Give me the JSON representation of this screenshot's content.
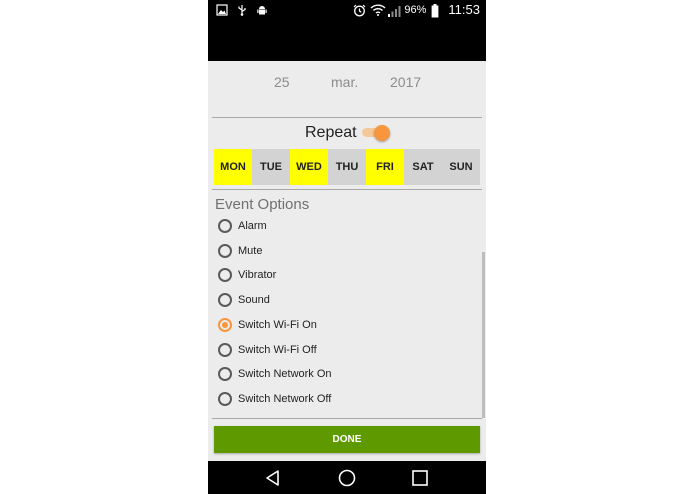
{
  "status_bar": {
    "battery_percent": "96%",
    "time": "11:53",
    "icons": [
      "image-icon",
      "usb-icon",
      "android-icon",
      "alarm-icon",
      "wifi-icon",
      "signal-icon",
      "battery-icon"
    ]
  },
  "date": {
    "day": "25",
    "month": "mar.",
    "year": "2017"
  },
  "repeat": {
    "label": "Repeat",
    "enabled": true
  },
  "days": [
    {
      "label": "MON",
      "selected": true
    },
    {
      "label": "TUE",
      "selected": false
    },
    {
      "label": "WED",
      "selected": true
    },
    {
      "label": "THU",
      "selected": false
    },
    {
      "label": "FRI",
      "selected": true
    },
    {
      "label": "SAT",
      "selected": false
    },
    {
      "label": "SUN",
      "selected": false
    }
  ],
  "event_options": {
    "title": "Event Options",
    "options": [
      {
        "label": "Alarm",
        "selected": false
      },
      {
        "label": "Mute",
        "selected": false
      },
      {
        "label": "Vibrator",
        "selected": false
      },
      {
        "label": "Sound",
        "selected": false
      },
      {
        "label": "Switch Wi-Fi On",
        "selected": true
      },
      {
        "label": "Switch Wi-Fi Off",
        "selected": false
      },
      {
        "label": "Switch Network On",
        "selected": false
      },
      {
        "label": "Switch Network Off",
        "selected": false
      }
    ]
  },
  "done_label": "DONE",
  "colors": {
    "accent": "#f7963c",
    "done": "#5f9900",
    "day_selected": "#ffff00",
    "day_default": "#d3d3d3"
  }
}
